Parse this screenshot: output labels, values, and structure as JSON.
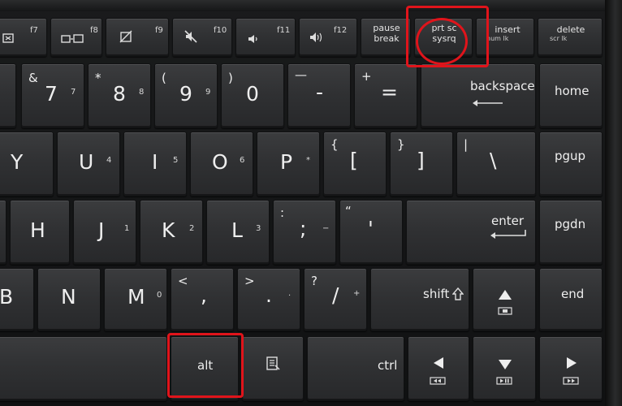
{
  "fn_row": {
    "f7": "f7",
    "f8": "f8",
    "f9": "f9",
    "f10": "f10",
    "f11": "f11",
    "f12": "f12",
    "pause_top": "pause",
    "pause_bottom": "break",
    "prtsc_top": "prt sc",
    "prtsc_bottom": "sysrq",
    "insert": "insert",
    "insert_sub": "num lk",
    "delete": "delete",
    "delete_sub": "scr lk"
  },
  "number_row": {
    "k7": "7",
    "k7_shift": "&",
    "k7_alt": "7",
    "k8": "8",
    "k8_shift": "*",
    "k8_alt": "8",
    "k9": "9",
    "k9_shift": "(",
    "k9_alt": "9",
    "k0": "0",
    "k0_shift": ")",
    "minus": "-",
    "minus_shift": "—",
    "equals": "=",
    "equals_shift": "+",
    "backspace": "backspace",
    "home": "home"
  },
  "top_row": {
    "y": "Y",
    "u": "U",
    "u_alt": "4",
    "i": "I",
    "i_alt": "5",
    "o": "O",
    "o_alt": "6",
    "p": "P",
    "p_alt": "*",
    "lbracket": "[",
    "lbracket_shift": "{",
    "rbracket": "]",
    "rbracket_shift": "}",
    "backslash": "\\",
    "backslash_shift": "|",
    "pgup": "pgup"
  },
  "home_row": {
    "h": "H",
    "j": "J",
    "j_alt": "1",
    "k": "K",
    "k_alt": "2",
    "l": "L",
    "l_alt": "3",
    "semicolon": ";",
    "semicolon_shift": ":",
    "semicolon_alt": "−",
    "quote": "'",
    "quote_shift": "“",
    "enter": "enter",
    "pgdn": "pgdn"
  },
  "bottom_row": {
    "b": "B",
    "n": "N",
    "m": "M",
    "m_alt": "0",
    "comma": ",",
    "comma_shift": "<",
    "period": ".",
    "period_shift": ">",
    "period_alt": ".",
    "slash": "/",
    "slash_shift": "?",
    "slash_alt": "+",
    "shift": "shift",
    "end": "end"
  },
  "space_row": {
    "alt": "alt",
    "ctrl": "ctrl"
  },
  "highlight_color": "#e0141b"
}
